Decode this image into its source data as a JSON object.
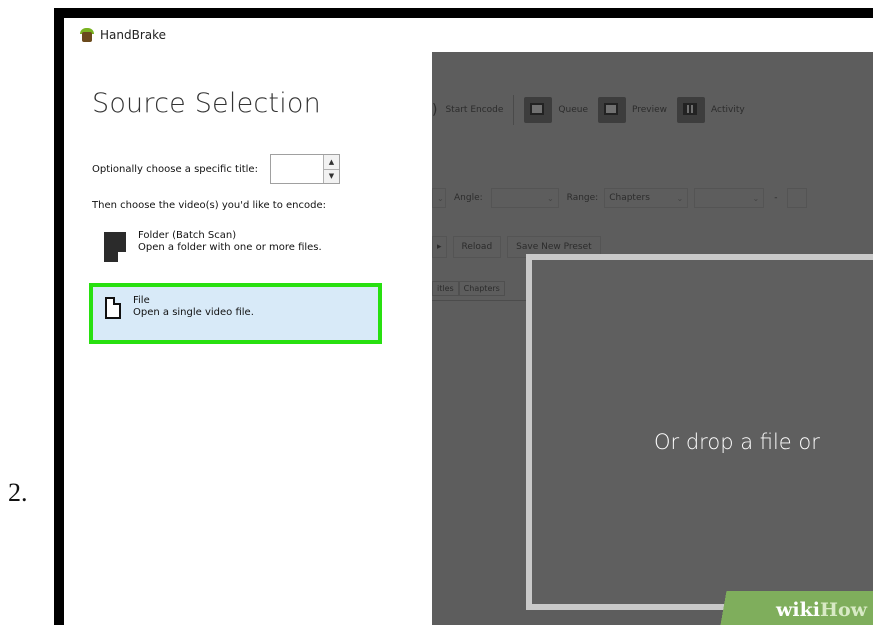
{
  "step_number": "2.",
  "window": {
    "app_title": "HandBrake",
    "brand_color": "#79b321"
  },
  "source_selection": {
    "heading": "Source Selection",
    "title_prompt": "Optionally choose a specific title:",
    "title_value": "",
    "encode_prompt": "Then choose the video(s) you'd like to encode:",
    "options": [
      {
        "title": "Folder (Batch Scan)",
        "description": "Open a folder with one or more files.",
        "icon": "folder-batch-icon"
      },
      {
        "title": "File",
        "description": "Open a single video file.",
        "icon": "file-icon",
        "highlighted": true,
        "highlight_color": "#28e010"
      }
    ]
  },
  "background_app": {
    "toolbar": [
      {
        "label": "Start Encode"
      },
      {
        "label": "Queue",
        "icon": "queue-icon"
      },
      {
        "label": "Preview",
        "icon": "preview-icon"
      },
      {
        "label": "Activity",
        "icon": "activity-icon"
      }
    ],
    "angle_label": "Angle:",
    "range_label": "Range:",
    "range_value": "Chapters",
    "range_sep": "-",
    "reload_label": "Reload",
    "save_preset_label": "Save New Preset",
    "tabs": [
      "itles",
      "Chapters"
    ],
    "drop_text": "Or drop a file or"
  },
  "watermark": {
    "part1": "wiki",
    "part2": "How"
  }
}
